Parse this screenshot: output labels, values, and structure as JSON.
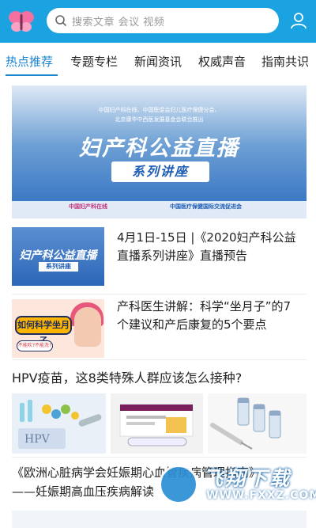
{
  "header": {
    "search_placeholder": "搜索文章 会议 视频",
    "accent": "#1aa3e0"
  },
  "tabs": [
    {
      "label": "热点推荐",
      "active": true
    },
    {
      "label": "专题专栏",
      "active": false
    },
    {
      "label": "新闻资讯",
      "active": false
    },
    {
      "label": "权威声音",
      "active": false
    },
    {
      "label": "指南共识",
      "active": false
    }
  ],
  "hero": {
    "org_line1": "中国妇产科在线、中国医促会妇儿医疗保健分会、",
    "org_line2": "北京康华中西医发展基金会联合推出",
    "title": "妇产科公益直播",
    "subtitle": "系列讲座",
    "logo_left": "中国妇产科在线",
    "logo_right": "中国医疗保健国际交流促进会"
  },
  "articles": [
    {
      "title": "4月1日-15日 |《2020妇产科公益直播系列讲座》直播预告",
      "thumb_title": "妇产科公益直播",
      "thumb_sub": "系列讲座"
    },
    {
      "title": "产科医生讲解：科学“坐月子”的7个建议和产后康复的5个要点",
      "thumb_bubble": "如何科学坐月子",
      "thumb_bubble2": "不能吹?不能洗?"
    }
  ],
  "hpv_article": {
    "title": "HPV疫苗，这8类特殊人群应该怎么接种?",
    "img1_label": "HPV"
  },
  "article4": {
    "title_line1": "《欧洲心脏病学会妊娠期心血管疾病管理指南》",
    "title_line2": "——妊娠期高血压疾病解读"
  },
  "watermark": {
    "text": "飞翔下载",
    "url": "WWW.FXXZ.COM"
  }
}
